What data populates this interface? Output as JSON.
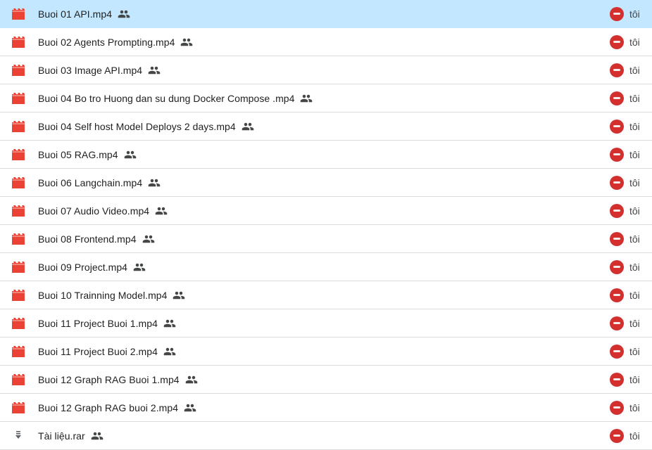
{
  "colors": {
    "selected_row": "#c2e7ff",
    "video_icon": "#ea4335",
    "avatar": "#d32f2f"
  },
  "files": [
    {
      "name": "Buoi 01 API.mp4",
      "type": "video",
      "owner": "tôi",
      "selected": true
    },
    {
      "name": "Buoi 02 Agents Prompting.mp4",
      "type": "video",
      "owner": "tôi"
    },
    {
      "name": "Buoi 03 Image API.mp4",
      "type": "video",
      "owner": "tôi"
    },
    {
      "name": "Buoi 04 Bo tro Huong dan su dung Docker Compose .mp4",
      "type": "video",
      "owner": "tôi"
    },
    {
      "name": "Buoi 04 Self host Model Deploys 2 days.mp4",
      "type": "video",
      "owner": "tôi"
    },
    {
      "name": "Buoi 05 RAG.mp4",
      "type": "video",
      "owner": "tôi"
    },
    {
      "name": "Buoi 06 Langchain.mp4",
      "type": "video",
      "owner": "tôi"
    },
    {
      "name": "Buoi 07 Audio Video.mp4",
      "type": "video",
      "owner": "tôi"
    },
    {
      "name": "Buoi 08 Frontend.mp4",
      "type": "video",
      "owner": "tôi"
    },
    {
      "name": "Buoi 09 Project.mp4",
      "type": "video",
      "owner": "tôi"
    },
    {
      "name": "Buoi 10 Trainning Model.mp4",
      "type": "video",
      "owner": "tôi"
    },
    {
      "name": "Buoi 11 Project Buoi 1.mp4",
      "type": "video",
      "owner": "tôi"
    },
    {
      "name": "Buoi 11 Project Buoi 2.mp4",
      "type": "video",
      "owner": "tôi"
    },
    {
      "name": "Buoi 12 Graph RAG Buoi 1.mp4",
      "type": "video",
      "owner": "tôi"
    },
    {
      "name": "Buoi 12 Graph RAG buoi 2.mp4",
      "type": "video",
      "owner": "tôi"
    },
    {
      "name": "Tài liệu.rar",
      "type": "archive",
      "owner": "tôi"
    }
  ]
}
